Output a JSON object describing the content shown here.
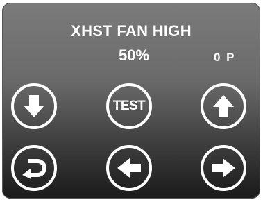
{
  "display": {
    "title": "XHST FAN HIGH",
    "value": "50%",
    "status": "0 P"
  },
  "buttons": {
    "down": {
      "icon": "arrow-down-icon"
    },
    "test": {
      "label": "TEST"
    },
    "up": {
      "icon": "arrow-up-icon"
    },
    "back": {
      "icon": "return-icon"
    },
    "left": {
      "icon": "arrow-left-icon"
    },
    "right": {
      "icon": "arrow-right-icon"
    }
  },
  "colors": {
    "screen_top": "#7b7b7b",
    "screen_bottom": "#1a1a1a",
    "foreground": "#ffffff"
  }
}
